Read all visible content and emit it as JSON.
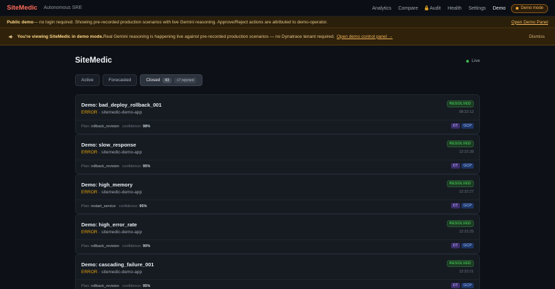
{
  "app": {
    "brand": "SiteMedic",
    "subtitle": "Autonomous SRE"
  },
  "nav": {
    "links": [
      {
        "label": "Analytics"
      },
      {
        "label": "Compare"
      },
      {
        "label": "Audit"
      },
      {
        "label": "Health"
      },
      {
        "label": "Settings"
      },
      {
        "label": "Demo"
      }
    ],
    "demo_pill": "Demo mode"
  },
  "banner_public": {
    "bold": "Public demo",
    "text": " — no login required. Showing pre-recorded production scenarios with live Gemini reasoning. Approve/Reject actions are attributed to demo-operator.",
    "link": "Open Demo Panel"
  },
  "banner_demo": {
    "bold": "You're viewing SiteMedic in demo mode.",
    "text": " Real Gemini reasoning is happening live against pre-recorded production scenarios — no Dynatrace tenant required.",
    "link": "Open demo control panel →",
    "dismiss": "Dismiss"
  },
  "page": {
    "title": "SiteMedic",
    "live": "Live"
  },
  "tabs": {
    "active": "Active",
    "forecasted": "Forecasted",
    "closed": "Closed",
    "closed_count": "43",
    "closed_extra": "+7 rejected"
  },
  "incidents": [
    {
      "title": "Demo: bad_deploy_rollback_001",
      "severity": "ERROR",
      "service": " · sitemedic-demo-app",
      "status": "RESOLVED",
      "time": "08:22:12",
      "plan_label": "Plan:",
      "plan": "rollback_revision",
      "conf_label": "confidence:",
      "confidence": "98%",
      "tag1": "DT",
      "tag2": "GCP"
    },
    {
      "title": "Demo: slow_response",
      "severity": "ERROR",
      "service": " · sitemedic-demo-app",
      "status": "RESOLVED",
      "time": "12:22:28",
      "plan_label": "Plan:",
      "plan": "rollback_revision",
      "conf_label": "confidence:",
      "confidence": "95%",
      "tag1": "DT",
      "tag2": "GCP"
    },
    {
      "title": "Demo: high_memory",
      "severity": "ERROR",
      "service": " · sitemedic-demo-app",
      "status": "RESOLVED",
      "time": "12:22:27",
      "plan_label": "Plan:",
      "plan": "restart_service",
      "conf_label": "confidence:",
      "confidence": "95%",
      "tag1": "DT",
      "tag2": "GCP"
    },
    {
      "title": "Demo: high_error_rate",
      "severity": "ERROR",
      "service": " · sitemedic-demo-app",
      "status": "RESOLVED",
      "time": "12:22:25",
      "plan_label": "Plan:",
      "plan": "rollback_revision",
      "conf_label": "confidence:",
      "confidence": "90%",
      "tag1": "DT",
      "tag2": "GCP"
    },
    {
      "title": "Demo: cascading_failure_001",
      "severity": "ERROR",
      "service": " · sitemedic-demo-app",
      "status": "RESOLVED",
      "time": "12:22:21",
      "plan_label": "Plan:",
      "plan": "rollback_revision",
      "conf_label": "confidence:",
      "confidence": "95%",
      "tag1": "DT",
      "tag2": "GCP"
    }
  ]
}
